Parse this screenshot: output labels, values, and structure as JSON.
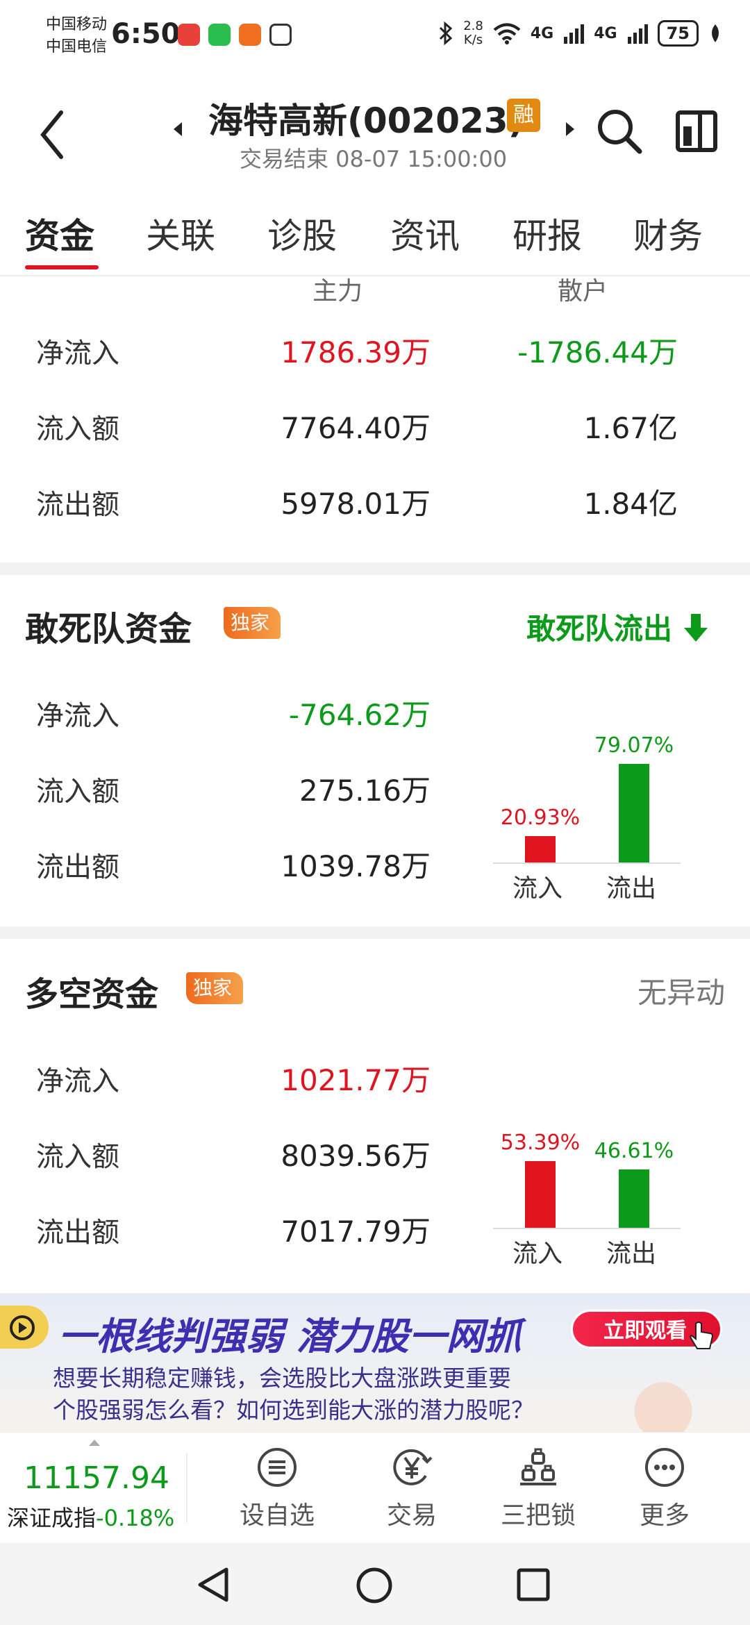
{
  "status_bar": {
    "carrier1": "中国移动",
    "carrier2": "中国电信",
    "time": "6:50",
    "net_speed_value": "2.8",
    "net_speed_unit": "K/s",
    "signal1": "4G",
    "signal2": "4G",
    "battery": "75"
  },
  "header": {
    "title": "海特高新(002023)",
    "margin_badge": "融",
    "subtitle": "交易结束 08-07 15:00:00"
  },
  "tabs": [
    "资金",
    "关联",
    "诊股",
    "资讯",
    "研报",
    "财务"
  ],
  "main_flow": {
    "col_main": "主力",
    "col_retail": "散户",
    "rows": [
      {
        "label": "净流入",
        "main": "1786.39万",
        "retail": "-1786.44万"
      },
      {
        "label": "流入额",
        "main": "7764.40万",
        "retail": "1.67亿"
      },
      {
        "label": "流出额",
        "main": "5978.01万",
        "retail": "1.84亿"
      }
    ]
  },
  "dare_fund": {
    "title": "敢死队资金",
    "badge": "独家",
    "status": "敢死队流出",
    "rows": [
      {
        "label": "净流入",
        "value": "-764.62万"
      },
      {
        "label": "流入额",
        "value": "275.16万"
      },
      {
        "label": "流出额",
        "value": "1039.78万"
      }
    ],
    "bars": [
      {
        "label": "流入",
        "pct_text": "20.93%",
        "pct": 20.93
      },
      {
        "label": "流出",
        "pct_text": "79.07%",
        "pct": 79.07
      }
    ]
  },
  "long_short_fund": {
    "title": "多空资金",
    "badge": "独家",
    "status": "无异动",
    "rows": [
      {
        "label": "净流入",
        "value": "1021.77万"
      },
      {
        "label": "流入额",
        "value": "8039.56万"
      },
      {
        "label": "流出额",
        "value": "7017.79万"
      }
    ],
    "bars": [
      {
        "label": "流入",
        "pct_text": "53.39%",
        "pct": 53.39
      },
      {
        "label": "流出",
        "pct_text": "46.61%",
        "pct": 46.61
      }
    ]
  },
  "ad": {
    "headline": "一根线判强弱 潜力股一网抓",
    "button": "立即观看",
    "line1": "想要长期稳定赚钱，会选股比大盘涨跌更重要",
    "line2": "个股强弱怎么看？如何选到能大涨的潜力股呢？"
  },
  "toolbar": {
    "index_value": "11157.94",
    "index_name": "深证成指",
    "index_change": "-0.18%",
    "items": [
      "设自选",
      "交易",
      "三把锁",
      "更多"
    ]
  },
  "colors": {
    "rise": "#e0141e",
    "fall": "#0c9a1a",
    "badge": "#ee6a1e"
  }
}
